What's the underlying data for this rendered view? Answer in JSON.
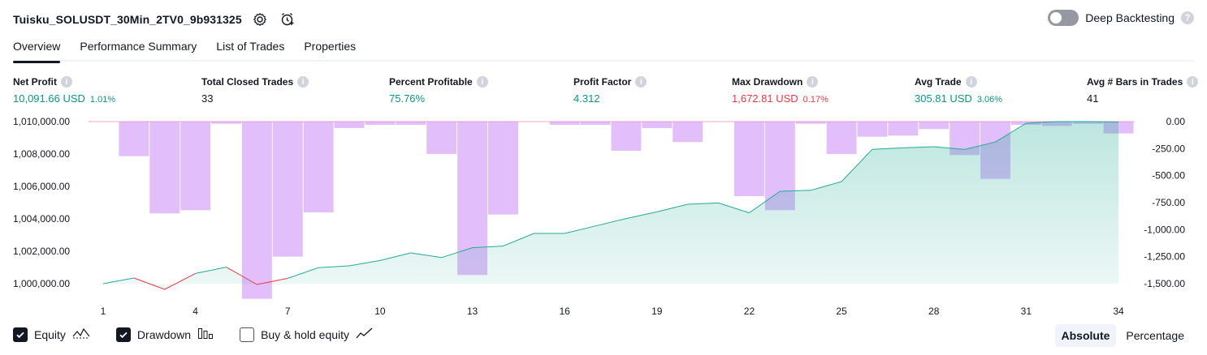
{
  "header": {
    "strategy_name": "Tuisku_SOLUSDT_30Min_2TV0_9b931325",
    "deep_backtesting_label": "Deep Backtesting",
    "deep_backtesting_on": false,
    "help_glyph": "?"
  },
  "tabs": [
    {
      "label": "Overview",
      "active": true
    },
    {
      "label": "Performance Summary",
      "active": false
    },
    {
      "label": "List of Trades",
      "active": false
    },
    {
      "label": "Properties",
      "active": false
    }
  ],
  "metrics": {
    "net_profit": {
      "label": "Net Profit",
      "value": "10,091.66 USD",
      "pct": "1.01%"
    },
    "total_closed_trades": {
      "label": "Total Closed Trades",
      "value": "33"
    },
    "percent_profitable": {
      "label": "Percent Profitable",
      "value": "75.76%"
    },
    "profit_factor": {
      "label": "Profit Factor",
      "value": "4.312"
    },
    "max_drawdown": {
      "label": "Max Drawdown",
      "value": "1,672.81 USD",
      "pct": "0.17%"
    },
    "avg_trade": {
      "label": "Avg Trade",
      "value": "305.81 USD",
      "pct": "3.06%"
    },
    "avg_bars": {
      "label": "Avg # Bars in Trades",
      "value": "41"
    },
    "info_glyph": "i"
  },
  "chart_data": {
    "type": "area",
    "x_ticks": [
      "1",
      "4",
      "7",
      "10",
      "13",
      "16",
      "19",
      "22",
      "25",
      "28",
      "31",
      "34"
    ],
    "left_axis": {
      "ticks": [
        "1,010,000.00",
        "1,008,000.00",
        "1,006,000.00",
        "1,004,000.00",
        "1,002,000.00",
        "1,000,000.00"
      ],
      "ylim": [
        999700,
        1010000
      ]
    },
    "right_axis": {
      "ticks": [
        "0.00",
        "-250.00",
        "-500.00",
        "-750.00",
        "-1,000.00",
        "-1,250.00",
        "-1,500.00"
      ],
      "ylim": [
        -1672.81,
        0
      ]
    },
    "series": [
      {
        "name": "Equity",
        "axis": "left",
        "x": [
          1,
          2,
          3,
          4,
          5,
          6,
          7,
          8,
          9,
          10,
          11,
          12,
          13,
          14,
          15,
          16,
          17,
          18,
          19,
          20,
          21,
          22,
          23,
          24,
          25,
          26,
          27,
          28,
          29,
          30,
          31,
          32,
          33,
          34
        ],
        "values": [
          1000000,
          1000350,
          999650,
          1000630,
          1001020,
          999950,
          1000330,
          1000990,
          1001100,
          1001430,
          1001900,
          1001610,
          1002220,
          1002320,
          1003100,
          1003100,
          1003560,
          1004020,
          1004430,
          1004900,
          1004980,
          1004370,
          1005700,
          1005760,
          1006300,
          1008290,
          1008380,
          1008450,
          1008280,
          1008740,
          1009900,
          1010000,
          1010000,
          1009970
        ]
      },
      {
        "name": "Drawdown",
        "axis": "right",
        "x": [
          1,
          2,
          3,
          4,
          5,
          6,
          7,
          8,
          9,
          10,
          11,
          12,
          13,
          14,
          15,
          16,
          17,
          18,
          19,
          20,
          21,
          22,
          23,
          24,
          25,
          26,
          27,
          28,
          29,
          30,
          31,
          32,
          33,
          34
        ],
        "values": [
          0,
          -320,
          -850,
          -820,
          -20,
          -1640,
          -1250,
          -840,
          -60,
          -30,
          -30,
          -300,
          -1420,
          -860,
          0,
          -30,
          -30,
          -270,
          -60,
          -190,
          0,
          -690,
          -820,
          -20,
          -300,
          -140,
          -130,
          -70,
          -310,
          -530,
          -30,
          -40,
          -20,
          -110
        ]
      }
    ],
    "colors": {
      "equity_line": "#22ab94",
      "equity_fill": "#22ab94",
      "equity_negative": "#f23645",
      "drawdown_bar": "#ce93f8",
      "zero_line": "#f7a6c6"
    }
  },
  "legend": {
    "equity": {
      "label": "Equity",
      "checked": true
    },
    "drawdown": {
      "label": "Drawdown",
      "checked": true
    },
    "buy_hold": {
      "label": "Buy & hold equity",
      "checked": false
    }
  },
  "modes": [
    {
      "label": "Absolute",
      "active": true
    },
    {
      "label": "Percentage",
      "active": false
    }
  ]
}
